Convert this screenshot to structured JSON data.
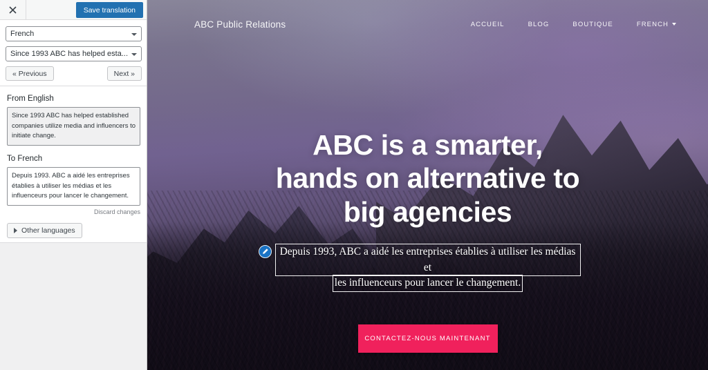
{
  "sidebar": {
    "close_label": "close-icon",
    "save_label": "Save translation",
    "language_select": "French",
    "string_select": "Since 1993 ABC has helped esta...",
    "prev_label": "« Previous",
    "next_label": "Next »",
    "from_label": "From English",
    "from_value": "Since 1993 ABC has helped established companies utilize media and influencers to initiate change.",
    "to_label": "To French",
    "to_value": "Depuis 1993. ABC a aidé les entreprises établies à utiliser les médias et les influenceurs pour lancer le changement.",
    "discard_label": "Discard changes",
    "other_languages_label": "Other languages",
    "accent_color": "#2271b1"
  },
  "site": {
    "brand": "ABC Public Relations",
    "nav": [
      {
        "label": "ACCUEIL"
      },
      {
        "label": "BLOG"
      },
      {
        "label": "BOUTIQUE"
      },
      {
        "label": "FRENCH"
      }
    ],
    "hero": {
      "headline_line1": "ABC is a smarter,",
      "headline_line2": "hands on alternative to",
      "headline_line3": "big agencies",
      "subtitle_line1": "Depuis 1993, ABC a aidé les entreprises établies à utiliser les médias et",
      "subtitle_line2": "les influenceurs pour lancer le changement.",
      "cta_label": "CONTACTEZ-NOUS MAINTENANT",
      "cta_color": "#f0215c",
      "edit_icon_color": "#1a73c4"
    }
  }
}
